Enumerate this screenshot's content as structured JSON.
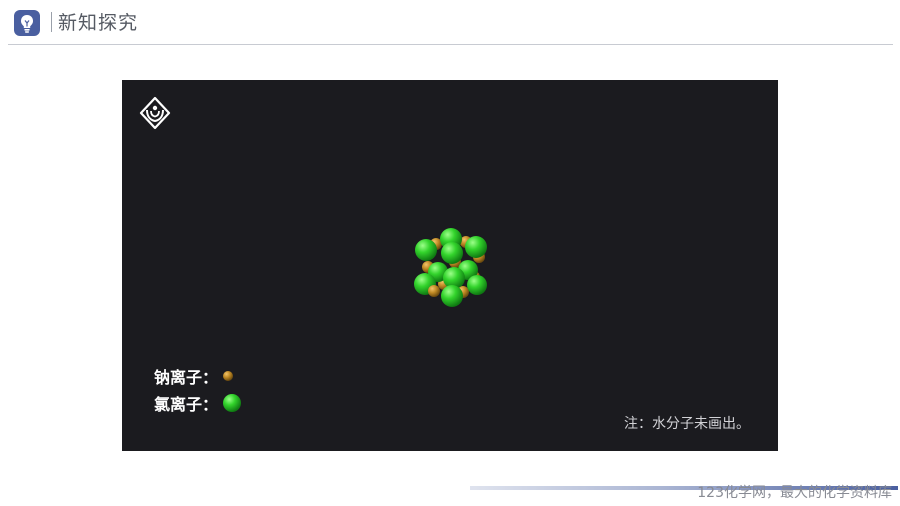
{
  "header": {
    "icon": "lightbulb-icon",
    "title": "新知探究"
  },
  "video": {
    "logo_icon": "hands-logo-icon",
    "illustration": "sodium-chloride-crystal",
    "legend": [
      {
        "label": "钠离子：",
        "color": "#c9962a"
      },
      {
        "label": "氯离子：",
        "color": "#3fd43a"
      }
    ],
    "note": "注：水分子未画出。"
  },
  "footer": {
    "text": "123化学网，最大的化学资料库"
  }
}
